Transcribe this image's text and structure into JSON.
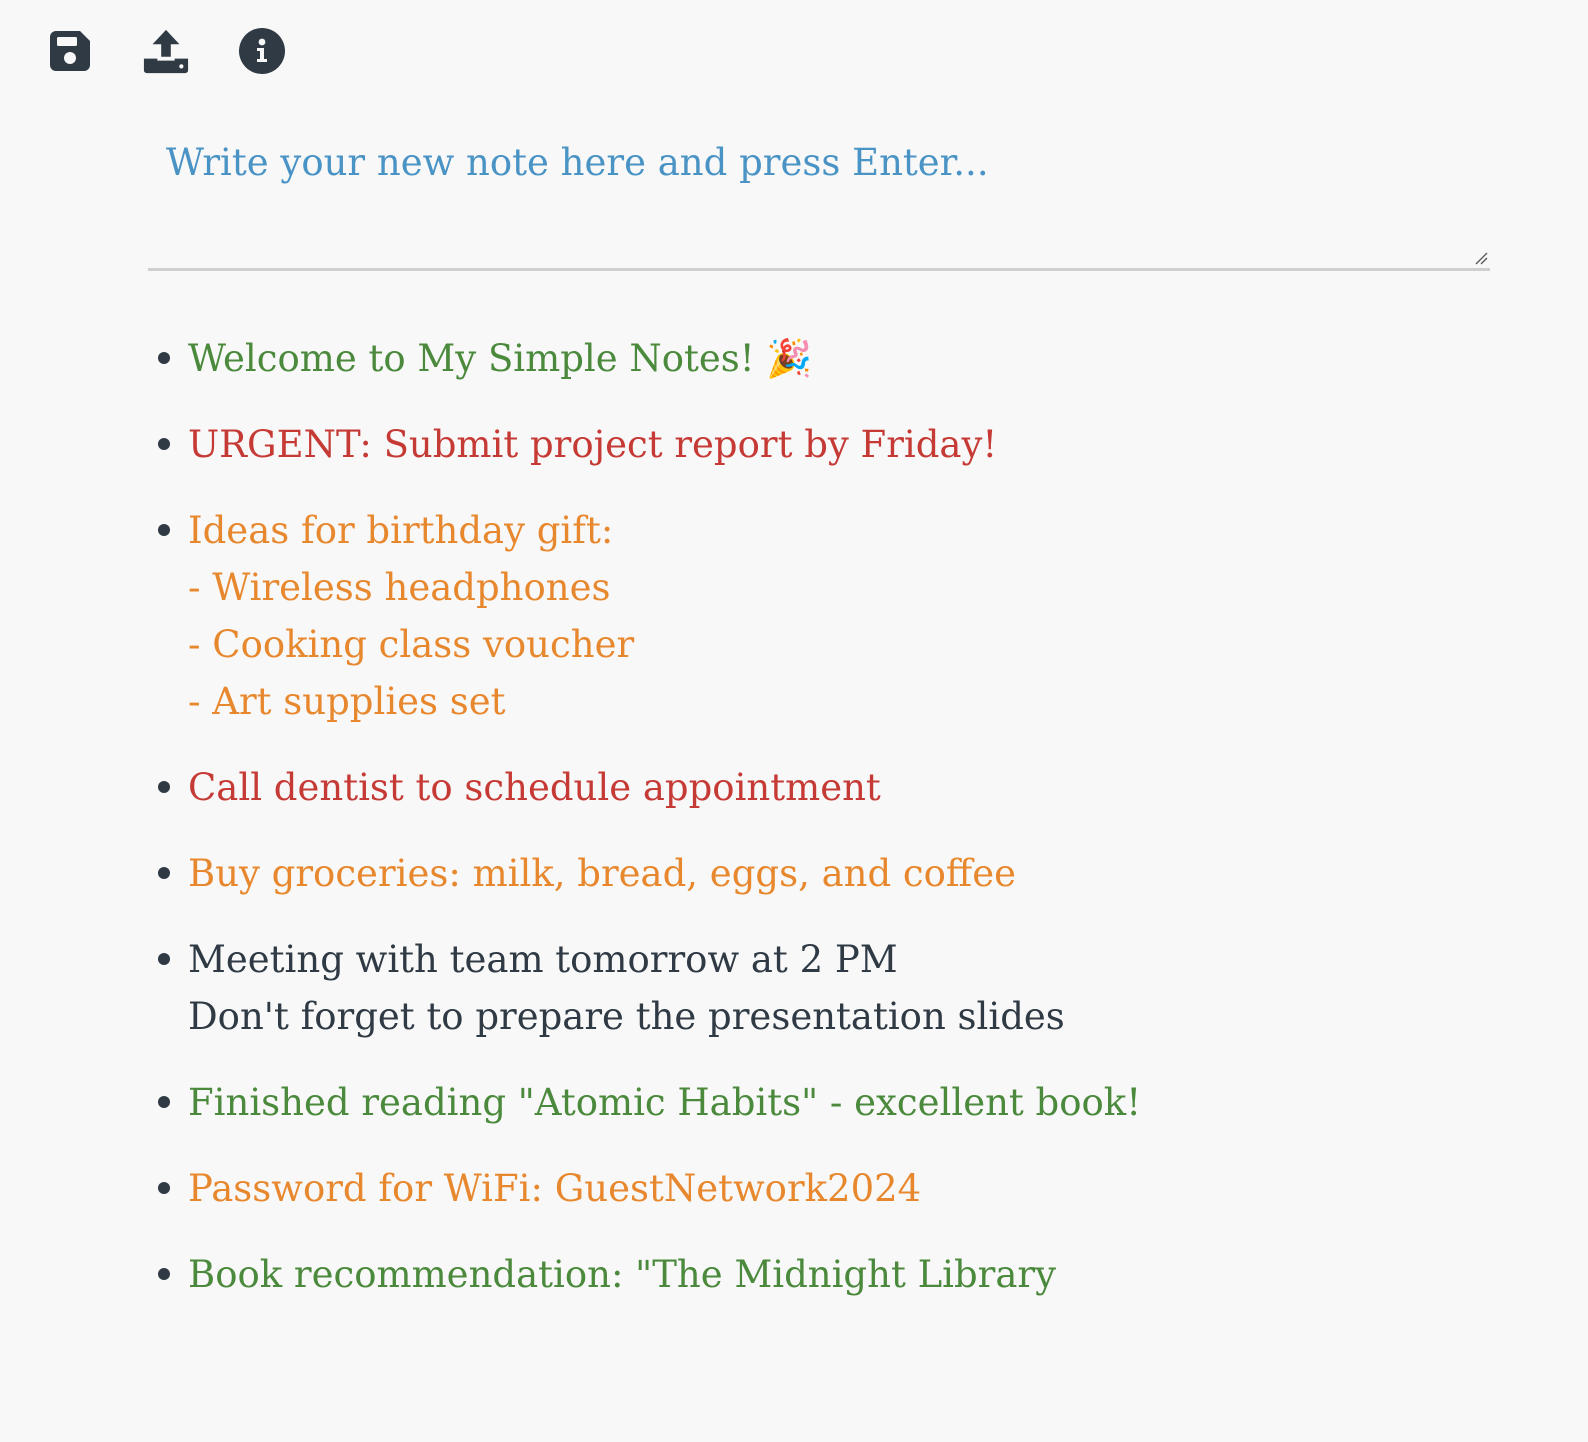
{
  "toolbar": {
    "save_icon": "save-icon",
    "upload_icon": "upload-icon",
    "info_icon": "info-icon",
    "icon_color": "#2f3a45"
  },
  "composer": {
    "value": "",
    "placeholder": "Write your new note here and press Enter..."
  },
  "colors": {
    "green": "#4b8a3c",
    "red": "#c63a36",
    "orange": "#e8882e",
    "dark": "#2f3a45",
    "placeholder": "#4a93c5",
    "background": "#f8f8f8"
  },
  "notes": [
    {
      "text": "Welcome to My Simple Notes! 🎉",
      "color": "green"
    },
    {
      "text": "URGENT: Submit project report by Friday!",
      "color": "red"
    },
    {
      "text": "Ideas for birthday gift:\n- Wireless headphones\n- Cooking class voucher\n- Art supplies set",
      "color": "orange"
    },
    {
      "text": "Call dentist to schedule appointment",
      "color": "red"
    },
    {
      "text": "Buy groceries: milk, bread, eggs, and coffee",
      "color": "orange"
    },
    {
      "text": "Meeting with team tomorrow at 2 PM\nDon't forget to prepare the presentation slides",
      "color": "dark"
    },
    {
      "text": "Finished reading \"Atomic Habits\" - excellent book!",
      "color": "green"
    },
    {
      "text": "Password for WiFi: GuestNetwork2024",
      "color": "orange"
    },
    {
      "text": "Book recommendation: \"The Midnight Library",
      "color": "green"
    }
  ]
}
